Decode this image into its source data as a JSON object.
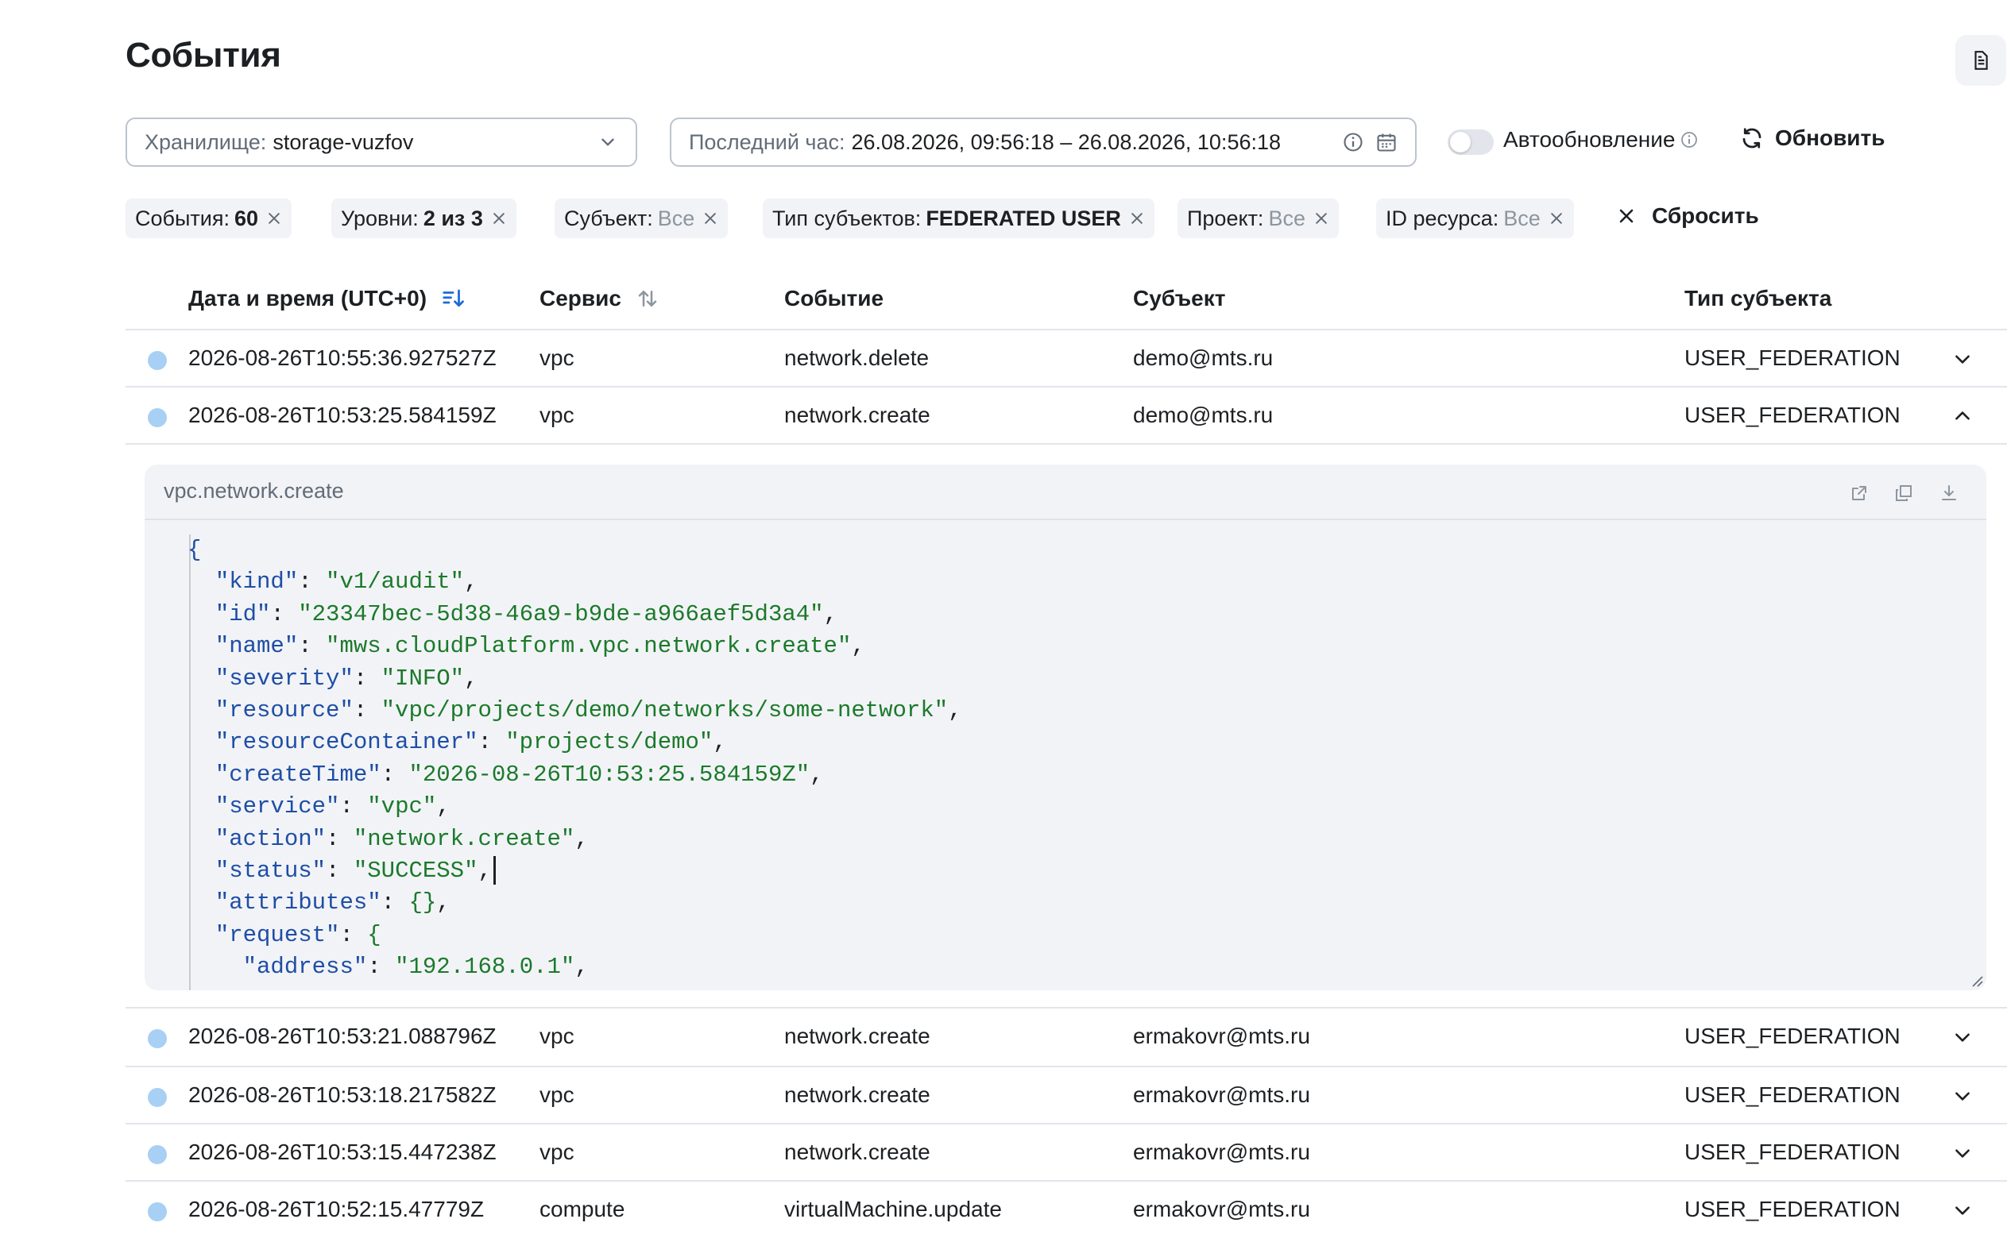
{
  "header": {
    "title": "События",
    "doc_icon": "document-icon"
  },
  "controls": {
    "storage": {
      "label": "Хранилище:",
      "value": "storage-vuzfov"
    },
    "date_range": {
      "label": "Последний час:",
      "value": "26.08.2026, 09:56:18 – 26.08.2026, 10:56:18"
    },
    "auto_refresh": {
      "label": "Автообновление",
      "enabled": false
    },
    "refresh_label": "Обновить"
  },
  "filters": [
    {
      "key": "События:",
      "value": "60",
      "muted": false
    },
    {
      "key": "Уровни:",
      "value": "2 из 3",
      "muted": false
    },
    {
      "key": "Субъект:",
      "value": "Все",
      "muted": true
    },
    {
      "key": "Тип субъектов:",
      "value": "FEDERATED USER",
      "muted": false
    },
    {
      "key": "Проект:",
      "value": "Все",
      "muted": true
    },
    {
      "key": "ID ресурса:",
      "value": "Все",
      "muted": true
    }
  ],
  "reset_label": "Сбросить",
  "table": {
    "columns": [
      "Дата и время (UTC+0)",
      "Сервис",
      "Событие",
      "Субъект",
      "Тип субъекта"
    ],
    "rows": [
      {
        "datetime": "2026-08-26T10:55:36.927527Z",
        "service": "vpc",
        "event": "network.delete",
        "subject": "demo@mts.ru",
        "subject_type": "USER_FEDERATION",
        "expanded": false
      },
      {
        "datetime": "2026-08-26T10:53:25.584159Z",
        "service": "vpc",
        "event": "network.create",
        "subject": "demo@mts.ru",
        "subject_type": "USER_FEDERATION",
        "expanded": true
      },
      {
        "datetime": "2026-08-26T10:53:21.088796Z",
        "service": "vpc",
        "event": "network.create",
        "subject": "ermakovr@mts.ru",
        "subject_type": "USER_FEDERATION",
        "expanded": false
      },
      {
        "datetime": "2026-08-26T10:53:18.217582Z",
        "service": "vpc",
        "event": "network.create",
        "subject": "ermakovr@mts.ru",
        "subject_type": "USER_FEDERATION",
        "expanded": false
      },
      {
        "datetime": "2026-08-26T10:53:15.447238Z",
        "service": "vpc",
        "event": "network.create",
        "subject": "ermakovr@mts.ru",
        "subject_type": "USER_FEDERATION",
        "expanded": false
      },
      {
        "datetime": "2026-08-26T10:52:15.47779Z",
        "service": "compute",
        "event": "virtualMachine.update",
        "subject": "ermakovr@mts.ru",
        "subject_type": "USER_FEDERATION",
        "expanded": false
      }
    ]
  },
  "detail": {
    "title": "vpc.network.create",
    "json_lines": [
      {
        "indent": 0,
        "key": "",
        "value": "{",
        "type": "brace"
      },
      {
        "indent": 1,
        "key": "kind",
        "value": "\"v1/audit\"",
        "type": "string",
        "comma": true
      },
      {
        "indent": 1,
        "key": "id",
        "value": "\"23347bec-5d38-46a9-b9de-a966aef5d3a4\"",
        "type": "string",
        "comma": true
      },
      {
        "indent": 1,
        "key": "name",
        "value": "\"mws.cloudPlatform.vpc.network.create\"",
        "type": "string",
        "comma": true
      },
      {
        "indent": 1,
        "key": "severity",
        "value": "\"INFO\"",
        "type": "string",
        "comma": true
      },
      {
        "indent": 1,
        "key": "resource",
        "value": "\"vpc/projects/demo/networks/some-network\"",
        "type": "string",
        "comma": true
      },
      {
        "indent": 1,
        "key": "resourceContainer",
        "value": "\"projects/demo\"",
        "type": "string",
        "comma": true
      },
      {
        "indent": 1,
        "key": "createTime",
        "value": "\"2026-08-26T10:53:25.584159Z\"",
        "type": "string",
        "comma": true
      },
      {
        "indent": 1,
        "key": "service",
        "value": "\"vpc\"",
        "type": "string",
        "comma": true
      },
      {
        "indent": 1,
        "key": "action",
        "value": "\"network.create\"",
        "type": "string",
        "comma": true
      },
      {
        "indent": 1,
        "key": "status",
        "value": "\"SUCCESS\"",
        "type": "string",
        "comma": true,
        "caret": true
      },
      {
        "indent": 1,
        "key": "attributes",
        "value": "{}",
        "type": "object",
        "comma": true
      },
      {
        "indent": 1,
        "key": "request",
        "value": "{",
        "type": "object",
        "comma": false
      },
      {
        "indent": 2,
        "key": "address",
        "value": "\"192.168.0.1\"",
        "type": "string",
        "comma": true
      }
    ]
  },
  "colors": {
    "status_dot": "#a8d0f5",
    "key": "#1e4ea5",
    "string": "#1b7a2a",
    "sort_active": "#1e6bd6"
  }
}
